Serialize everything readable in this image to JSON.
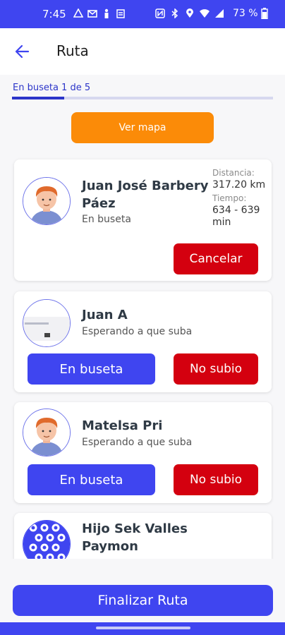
{
  "status_bar": {
    "time": "7:45",
    "battery_percent": "73 %",
    "background": "#3f45f0"
  },
  "app_bar": {
    "title": "Ruta",
    "back_icon": "arrow-left-icon"
  },
  "progress": {
    "label": "En buseta 1 de 5",
    "fraction": 0.2,
    "color": "#2c35c9"
  },
  "map_button": {
    "label": "Ver mapa",
    "color": "#fb8b08"
  },
  "passengers": [
    {
      "name": "Juan José Barbery Páez",
      "status": "En buseta",
      "avatar": "boy-avatar",
      "distance_label": "Distancia:",
      "distance_value": "317.20 km",
      "time_label": "Tiempo:",
      "time_value": "634 - 639 min",
      "cancel_label": "Cancelar"
    },
    {
      "name": "Juan A",
      "status": "Esperando a que suba",
      "avatar": "document-thumbnail-avatar",
      "board_label": "En buseta",
      "not_board_label": "No subio"
    },
    {
      "name": "Matelsa Pri",
      "status": "Esperando a que suba",
      "avatar": "boy-avatar",
      "board_label": "En buseta",
      "not_board_label": "No subio"
    },
    {
      "name": "Hijo Sek Valles Paymon",
      "avatar": "pattern-avatar"
    }
  ],
  "finish_button": {
    "label": "Finalizar Ruta",
    "color": "#3f45f0"
  },
  "colors": {
    "primary": "#3f45f0",
    "danger": "#d4000f",
    "accent": "#fb8b08"
  }
}
